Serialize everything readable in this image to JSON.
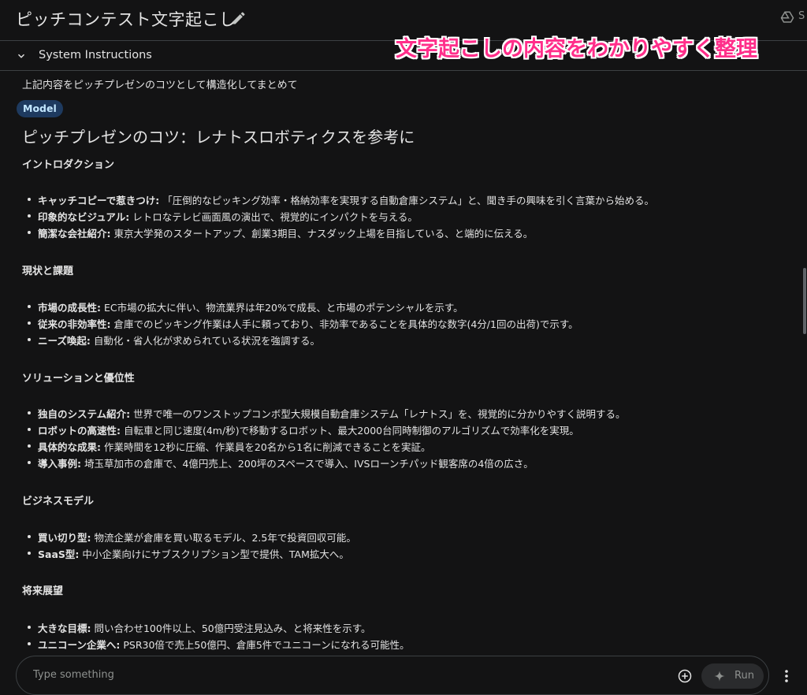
{
  "header": {
    "title": "ピッチコンテスト文字起こし",
    "right_partial": "S"
  },
  "system_instructions": {
    "label": "System Instructions"
  },
  "overlay_annotation": "文字起こしの内容をわかりやすく整理",
  "chat": {
    "user_prompt": "上記内容をピッチプレゼンのコツとして構造化してまとめて",
    "model_badge": "Model",
    "heading": "ピッチプレゼンのコツ：レナトスロボティクスを参考に",
    "sections": [
      {
        "title": "イントロダクション",
        "items": [
          {
            "term": "キャッチコピーで惹きつけ:",
            "text": " 「圧倒的なピッキング効率・格納効率を実現する自動倉庫システム」と、聞き手の興味を引く言葉から始める。"
          },
          {
            "term": "印象的なビジュアル:",
            "text": " レトロなテレビ画面風の演出で、視覚的にインパクトを与える。"
          },
          {
            "term": "簡潔な会社紹介:",
            "text": " 東京大学発のスタートアップ、創業3期目、ナスダック上場を目指している、と端的に伝える。"
          }
        ]
      },
      {
        "title": "現状と課題",
        "items": [
          {
            "term": "市場の成長性:",
            "text": " EC市場の拡大に伴い、物流業界は年20%で成長、と市場のポテンシャルを示す。"
          },
          {
            "term": "従来の非効率性:",
            "text": " 倉庫でのピッキング作業は人手に頼っており、非効率であることを具体的な数字(4分/1回の出荷)で示す。"
          },
          {
            "term": "ニーズ喚起:",
            "text": " 自動化・省人化が求められている状況を強調する。"
          }
        ]
      },
      {
        "title": "ソリューションと優位性",
        "items": [
          {
            "term": "独自のシステム紹介:",
            "text": " 世界で唯一のワンストップコンボ型大規模自動倉庫システム「レナトス」を、視覚的に分かりやすく説明する。"
          },
          {
            "term": "ロボットの高速性:",
            "text": " 自転車と同じ速度(4m/秒)で移動するロボット、最大2000台同時制御のアルゴリズムで効率化を実現。"
          },
          {
            "term": "具体的な成果:",
            "text": " 作業時間を12秒に圧縮、作業員を20名から1名に削減できることを実証。"
          },
          {
            "term": "導入事例:",
            "text": " 埼玉草加市の倉庫で、4億円売上、200坪のスペースで導入、IVSローンチパッド観客席の4倍の広さ。"
          }
        ]
      },
      {
        "title": "ビジネスモデル",
        "items": [
          {
            "term": "買い切り型:",
            "text": " 物流企業が倉庫を買い取るモデル、2.5年で投資回収可能。"
          },
          {
            "term": "SaaS型:",
            "text": " 中小企業向けにサブスクリプション型で提供、TAM拡大へ。"
          }
        ]
      },
      {
        "title": "将来展望",
        "items": [
          {
            "term": "大きな目標:",
            "text": " 問い合わせ100件以上、50億円受注見込み、と将来性を示す。"
          },
          {
            "term": "ユニコーン企業へ:",
            "text": " PSR30倍で売上50億円、倉庫5件でユニコーンになれる可能性。"
          }
        ]
      }
    ]
  },
  "composer": {
    "placeholder": "Type something",
    "run_label": "Run"
  },
  "colors": {
    "background": "#131314",
    "text": "#e3e3e3",
    "badge_bg": "#1e3a5f",
    "annotation": "#ff2e8a"
  },
  "icons": [
    "edit-icon",
    "drive-icon",
    "chevron-down-icon",
    "add-circle-icon",
    "sparkle-icon",
    "more-vert-icon"
  ]
}
